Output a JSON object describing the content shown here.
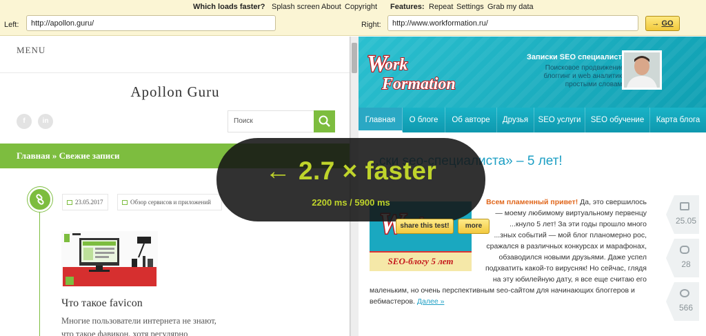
{
  "toolbar": {
    "question": "Which loads faster?",
    "links": [
      "Splash screen",
      "About",
      "Copyright"
    ],
    "features_label": "Features:",
    "features": [
      "Repeat",
      "Settings",
      "Grab my data"
    ],
    "left_label": "Left:",
    "left_url": "http://apollon.guru/",
    "right_label": "Right:",
    "right_url": "http://www.workformation.ru/",
    "go_arrow": "→",
    "go_label": "GO"
  },
  "left_site": {
    "menu": "MENU",
    "title": "Apollon Guru",
    "social": [
      "f",
      "in"
    ],
    "search_placeholder": "Поиск",
    "breadcrumb": "Главная » Свежие записи",
    "post": {
      "date": "23.05.2017",
      "category": "Обзор сервисов и приложений",
      "title": "Что такое favicon",
      "excerpt_lines": [
        "Многие пользователи интернета не знают,",
        "что такое фавикон, хотя регулярно"
      ]
    }
  },
  "right_site": {
    "logo_text": "WorkFormation",
    "tagline_title": "Записки SEO специалиста",
    "tagline_lines": [
      "Поисковое продвижение,",
      "блоггинг и web аналитика",
      "простыми словами"
    ],
    "nav": [
      "Главная",
      "О блоге",
      "Об авторе",
      "Друзья",
      "SEO услуги",
      "SEO обучение",
      "Карта блога"
    ],
    "post_title": "...ски seo-специалиста» – 5 лет!",
    "banner_caption": "SEO-блогу 5 лет",
    "text_lines": [
      "Всем пламенный привет! Да, это свершилось",
      "— моему любимому виртуальному первенцу",
      "...кнуло 5 лет! За эти годы прошло много",
      "...зных событий — мой блог планомерно рос,",
      "сражался в различных конкурсах и марафонах,",
      "обзаводился новыми друзьями. Даже успел",
      "подхватить какой-то вирусняк! Но сейчас, глядя",
      "на эту юбилейную дату, я все еще считаю его",
      "маленьким, но очень перспективным seo-сайтом для начинающих блоггеров и",
      "вебмастеров."
    ],
    "greeting": "Всем пламенный привет!",
    "more_link": "Далее »",
    "badges": [
      "25.05",
      "28",
      "566"
    ]
  },
  "overlay": {
    "headline": "← 2.7 × faster",
    "timing": "2200 ms / 5900 ms",
    "share_label": "share this test!",
    "more_label": "more"
  },
  "colors": {
    "toolbar_bg": "#fbf5d4",
    "left_accent": "#7dbd3f",
    "right_accent": "#1ab3c7",
    "overlay_text": "#bfd42b"
  }
}
